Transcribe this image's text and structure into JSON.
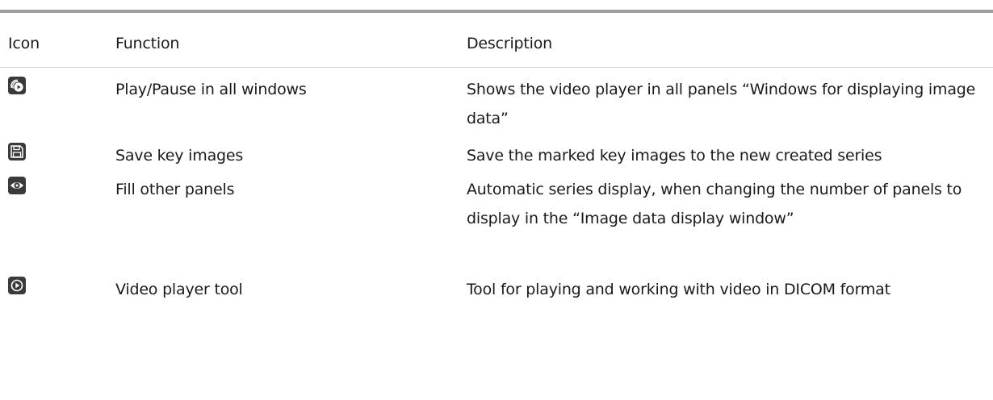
{
  "table": {
    "headers": {
      "icon": "Icon",
      "function": "Function",
      "description": "Description"
    },
    "rows": [
      {
        "icon": "play-pause-all-icon",
        "function": "Play/Pause in all windows",
        "description": "Shows the video player in all panels “Windows for displaying image data”"
      },
      {
        "icon": "save-icon",
        "function": "Save key images",
        "description": "Save the marked key images to the new created series"
      },
      {
        "icon": "eye-icon",
        "function": "Fill other panels",
        "description": "Automatic series display, when changing the number of panels to display in the “Image data display window”"
      },
      {
        "icon": "video-player-icon",
        "function": "Video player tool",
        "description": "Tool for playing and working with video in DICOM format"
      }
    ]
  },
  "colors": {
    "icon_fill": "#3a3a3a",
    "rule": "#9e9e9e",
    "divider": "#d4d4d4"
  }
}
